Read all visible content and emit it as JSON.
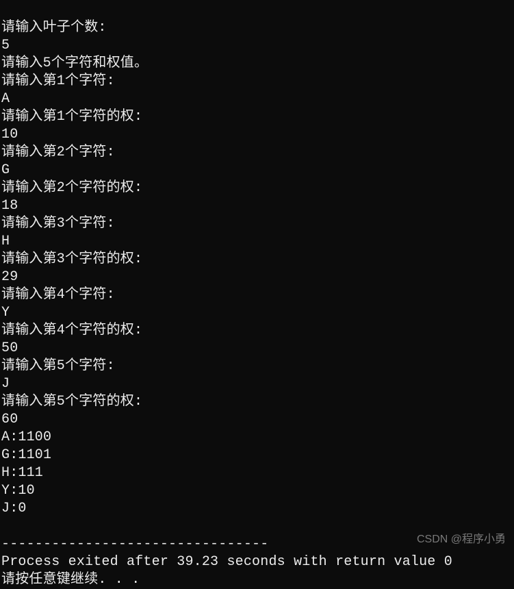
{
  "console": {
    "lines": [
      "请输入叶子个数:",
      "5",
      "请输入5个字符和权值。",
      "请输入第1个字符:",
      "A",
      "请输入第1个字符的权:",
      "10",
      "请输入第2个字符:",
      "G",
      "请输入第2个字符的权:",
      "18",
      "请输入第3个字符:",
      "H",
      "请输入第3个字符的权:",
      "29",
      "请输入第4个字符:",
      "Y",
      "请输入第4个字符的权:",
      "50",
      "请输入第5个字符:",
      "J",
      "请输入第5个字符的权:",
      "60",
      "A:1100",
      "G:1101",
      "H:111",
      "Y:10",
      "J:0",
      "",
      "--------------------------------",
      "Process exited after 39.23 seconds with return value 0",
      "请按任意键继续. . ."
    ]
  },
  "watermark": {
    "text": "CSDN @程序小勇"
  }
}
